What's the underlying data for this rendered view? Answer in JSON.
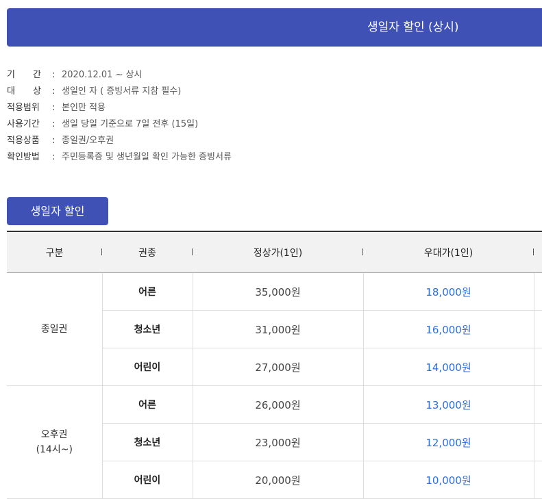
{
  "banner": {
    "title": "생일자 할인 (상시)"
  },
  "info": [
    {
      "label": "기간",
      "value": "2020.12.01 ~ 상시"
    },
    {
      "label": "대상",
      "value": "생일인 자 ( 증빙서류 지참 필수)"
    },
    {
      "label": "적용범위",
      "value": "본인만 적용"
    },
    {
      "label": "사용기간",
      "value": "생일 당일 기준으로 7일 전후 (15일)"
    },
    {
      "label": "적용상품",
      "value": "종일권/오후권"
    },
    {
      "label": "확인방법",
      "value": "주민등록증 및 생년월일 확인 가능한 증빙서류"
    }
  ],
  "section_tag": "생일자 할인",
  "table": {
    "headers": [
      "구분",
      "권종",
      "정상가(1인)",
      "우대가(1인)"
    ],
    "groups": [
      {
        "name_lines": [
          "종일권"
        ],
        "rows": [
          {
            "type": "어른",
            "regular": "35,000원",
            "discount": "18,000원"
          },
          {
            "type": "청소년",
            "regular": "31,000원",
            "discount": "16,000원"
          },
          {
            "type": "어린이",
            "regular": "27,000원",
            "discount": "14,000원"
          }
        ]
      },
      {
        "name_lines": [
          "오후권",
          "(14시~)"
        ],
        "rows": [
          {
            "type": "어른",
            "regular": "26,000원",
            "discount": "13,000원"
          },
          {
            "type": "청소년",
            "regular": "23,000원",
            "discount": "12,000원"
          },
          {
            "type": "어린이",
            "regular": "20,000원",
            "discount": "10,000원"
          }
        ]
      }
    ]
  },
  "colors": {
    "brand": "#3f51b5",
    "discount": "#2f6fd6"
  }
}
